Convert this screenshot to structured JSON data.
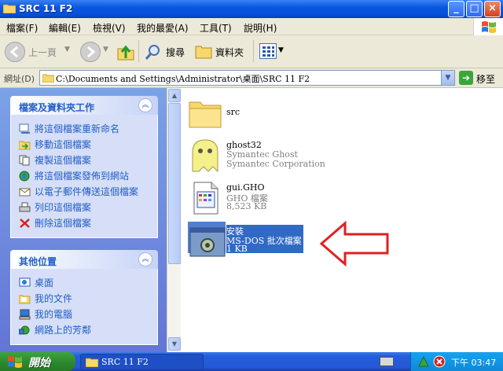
{
  "window": {
    "title": "SRC 11 F2"
  },
  "menu": [
    "檔案(F)",
    "編輯(E)",
    "檢視(V)",
    "我的最愛(A)",
    "工具(T)",
    "說明(H)"
  ],
  "toolbar": {
    "back": "上一頁",
    "search": "搜尋",
    "folders": "資料夾"
  },
  "address": {
    "label": "網址(D)",
    "value": "C:\\Documents and Settings\\Administrator\\桌面\\SRC 11 F2",
    "go": "移至"
  },
  "tasks_panel": {
    "title": "檔案及資料夾工作",
    "items": [
      "將這個檔案重新命名",
      "移動這個檔案",
      "複製這個檔案",
      "將這個檔案發佈到網站",
      "以電子郵件傳送這個檔案",
      "列印這個檔案",
      "刪除這個檔案"
    ]
  },
  "places_panel": {
    "title": "其他位置",
    "items": [
      "桌面",
      "我的文件",
      "我的電腦",
      "網路上的芳鄰"
    ]
  },
  "files": [
    {
      "name": "src",
      "line2": "",
      "line3": ""
    },
    {
      "name": "ghost32",
      "line2": "Symantec Ghost",
      "line3": "Symantec Corporation"
    },
    {
      "name": "gui.GHO",
      "line2": "GHO 檔案",
      "line3": "8,523 KB"
    },
    {
      "name": "安裝",
      "line2": "MS-DOS 批次檔案",
      "line3": "1 KB"
    }
  ],
  "taskbar": {
    "start": "開始",
    "task": "SRC 11 F2",
    "clock": "下午 03:47"
  }
}
